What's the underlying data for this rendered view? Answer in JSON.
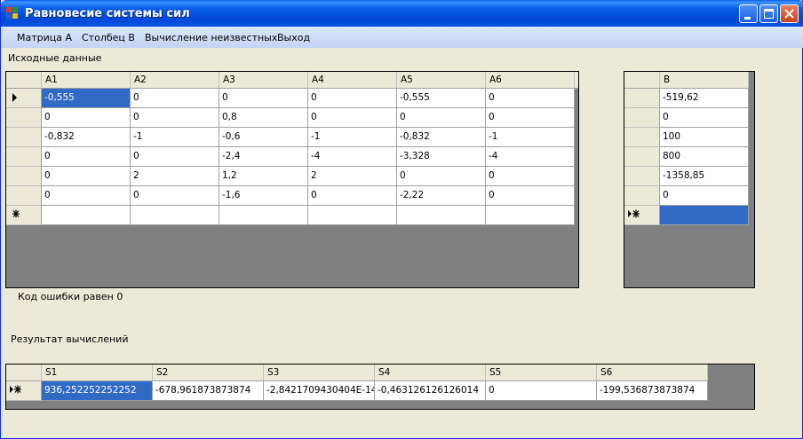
{
  "window": {
    "title": "Равновесие системы сил"
  },
  "menu": [
    "Матрица А",
    "Столбец В",
    "Вычисление неизвестных",
    "Выход"
  ],
  "labels": {
    "source": "Исходные данные",
    "error": "Код ошибки равен 0",
    "result": "Результат вычислений"
  },
  "matrix_a": {
    "columns": [
      "A1",
      "A2",
      "A3",
      "A4",
      "A5",
      "A6"
    ],
    "rows": [
      [
        "-0,555",
        "0",
        "0",
        "0",
        "-0,555",
        "0"
      ],
      [
        "0",
        "0",
        "0,8",
        "0",
        "0",
        "0"
      ],
      [
        "-0,832",
        "-1",
        "-0,6",
        "-1",
        "-0,832",
        "-1"
      ],
      [
        "0",
        "0",
        "-2,4",
        "-4",
        "-3,328",
        "-4"
      ],
      [
        "0",
        "2",
        "1,2",
        "2",
        "0",
        "0"
      ],
      [
        "0",
        "0",
        "-1,6",
        "0",
        "-2,22",
        "0"
      ]
    ]
  },
  "vector_b": {
    "columns": [
      "B"
    ],
    "rows": [
      "-519,62",
      "0",
      "100",
      "800",
      "-1358,85",
      "0"
    ]
  },
  "result": {
    "columns": [
      "S1",
      "S2",
      "S3",
      "S4",
      "S5",
      "S6"
    ],
    "values": [
      "936,252252252252",
      "-678,961873873874",
      "-2,8421709430404E-14",
      "-0,463126126126014",
      "0",
      "-199,536873873874"
    ]
  },
  "colors": {
    "selection": "#316ac5",
    "grid_bg": "#808080",
    "title_bar": "#0a5ee8"
  },
  "icons": {
    "current_row": "row-pointer-icon",
    "new_row": "new-row-icon"
  }
}
